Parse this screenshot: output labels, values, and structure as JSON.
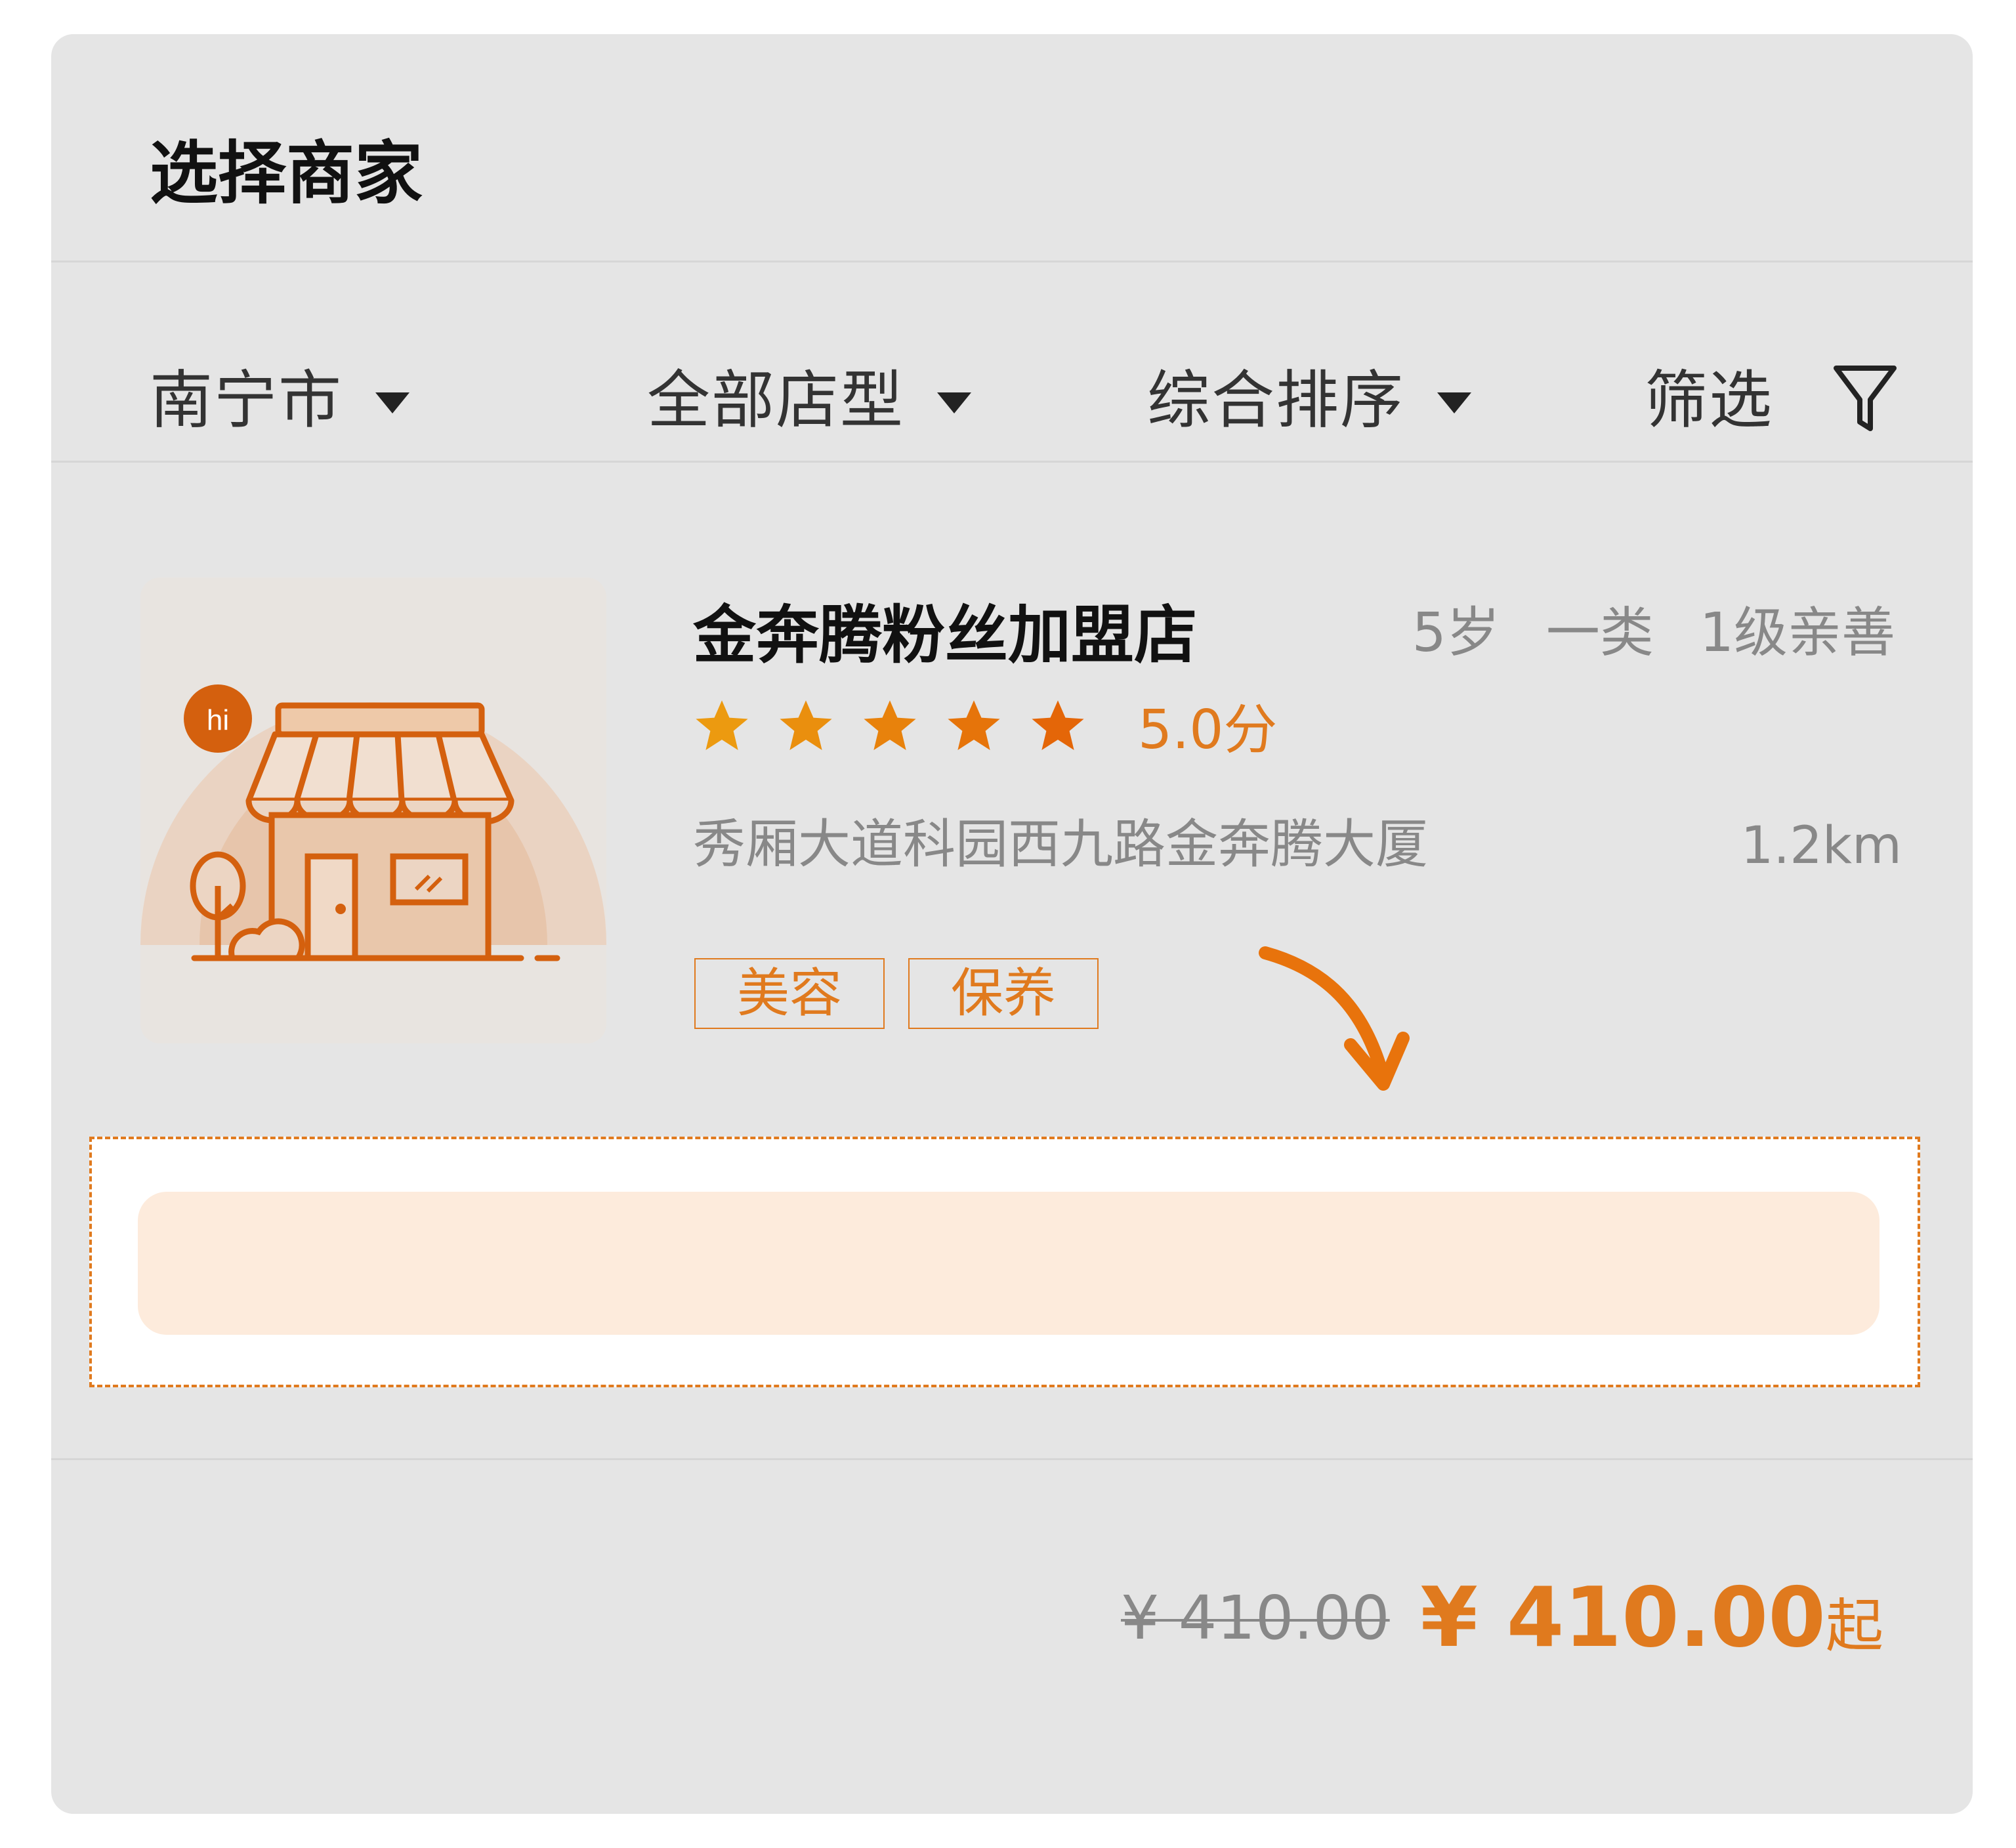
{
  "header": {
    "title": "选择商家"
  },
  "filters": {
    "city": "南宁市",
    "store_type": "全部店型",
    "sort": "综合排序",
    "filter": "筛选"
  },
  "shop": {
    "image_badge": "hi",
    "name": "金奔腾粉丝加盟店",
    "meta": [
      "5岁",
      "一类",
      "1级亲善"
    ],
    "rating_stars": 5,
    "rating_text": "5.0分",
    "address": "秀厢大道科园西九路金奔腾大厦",
    "distance": "1.2km",
    "categories": [
      "美容",
      "保养"
    ]
  },
  "price": {
    "original": "¥ 410.00",
    "current": "¥ 410.00",
    "suffix": "起"
  },
  "colors": {
    "accent": "#e07a1e",
    "card_bg": "#e5e5e5",
    "promo_bar": "#fdebdc",
    "text_muted": "#888888"
  }
}
